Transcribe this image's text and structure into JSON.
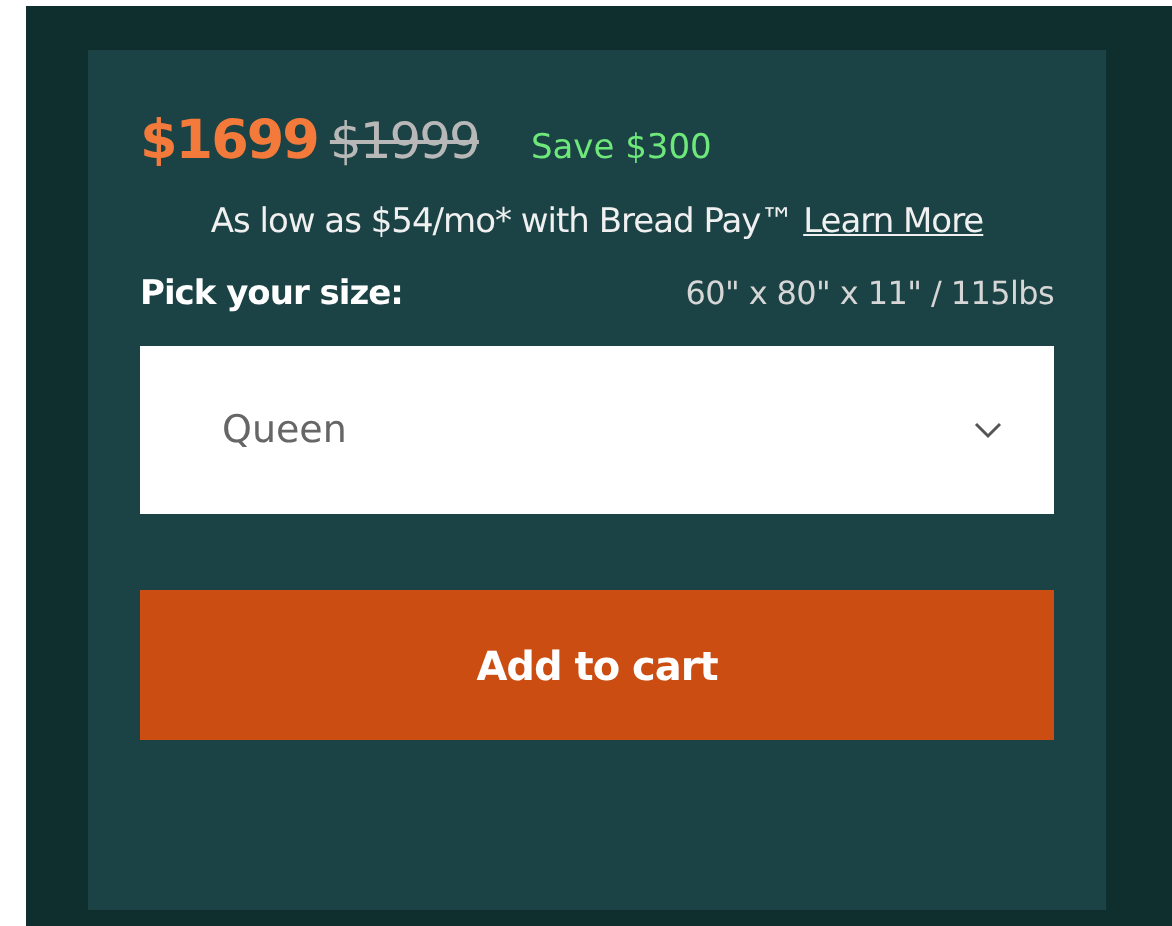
{
  "price": {
    "current": "$1699",
    "original": "$1999",
    "savings": "Save $300"
  },
  "financing": {
    "text": "As low as $54/mo* with Bread Pay™",
    "link": "Learn More"
  },
  "size": {
    "label": "Pick your size:",
    "dimensions": "60\" x 80\" x 11\" / 115lbs",
    "value": "Queen"
  },
  "button": "Add to cart"
}
